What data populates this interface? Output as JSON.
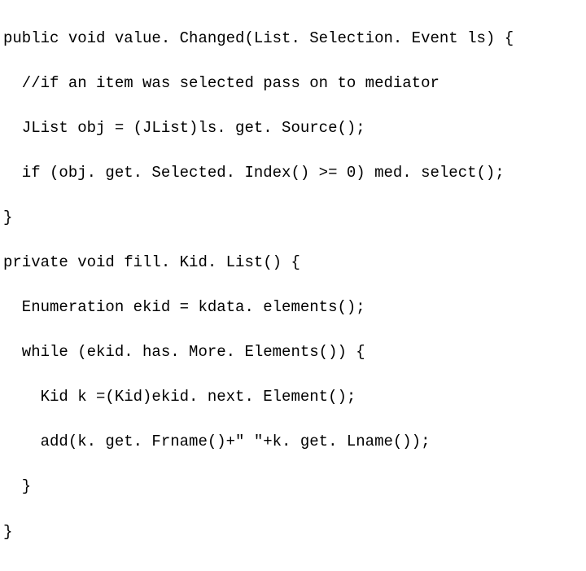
{
  "code": {
    "lines": [
      "public void value. Changed(List. Selection. Event ls) {",
      "  //if an item was selected pass on to mediator",
      "  JList obj = (JList)ls. get. Source();",
      "  if (obj. get. Selected. Index() >= 0) med. select();",
      "}",
      "private void fill. Kid. List() {",
      "  Enumeration ekid = kdata. elements();",
      "  while (ekid. has. More. Elements()) {",
      "    Kid k =(Kid)ekid. next. Element();",
      "    add(k. get. Frname()+\" \"+k. get. Lname());",
      "  }",
      "}"
    ]
  }
}
